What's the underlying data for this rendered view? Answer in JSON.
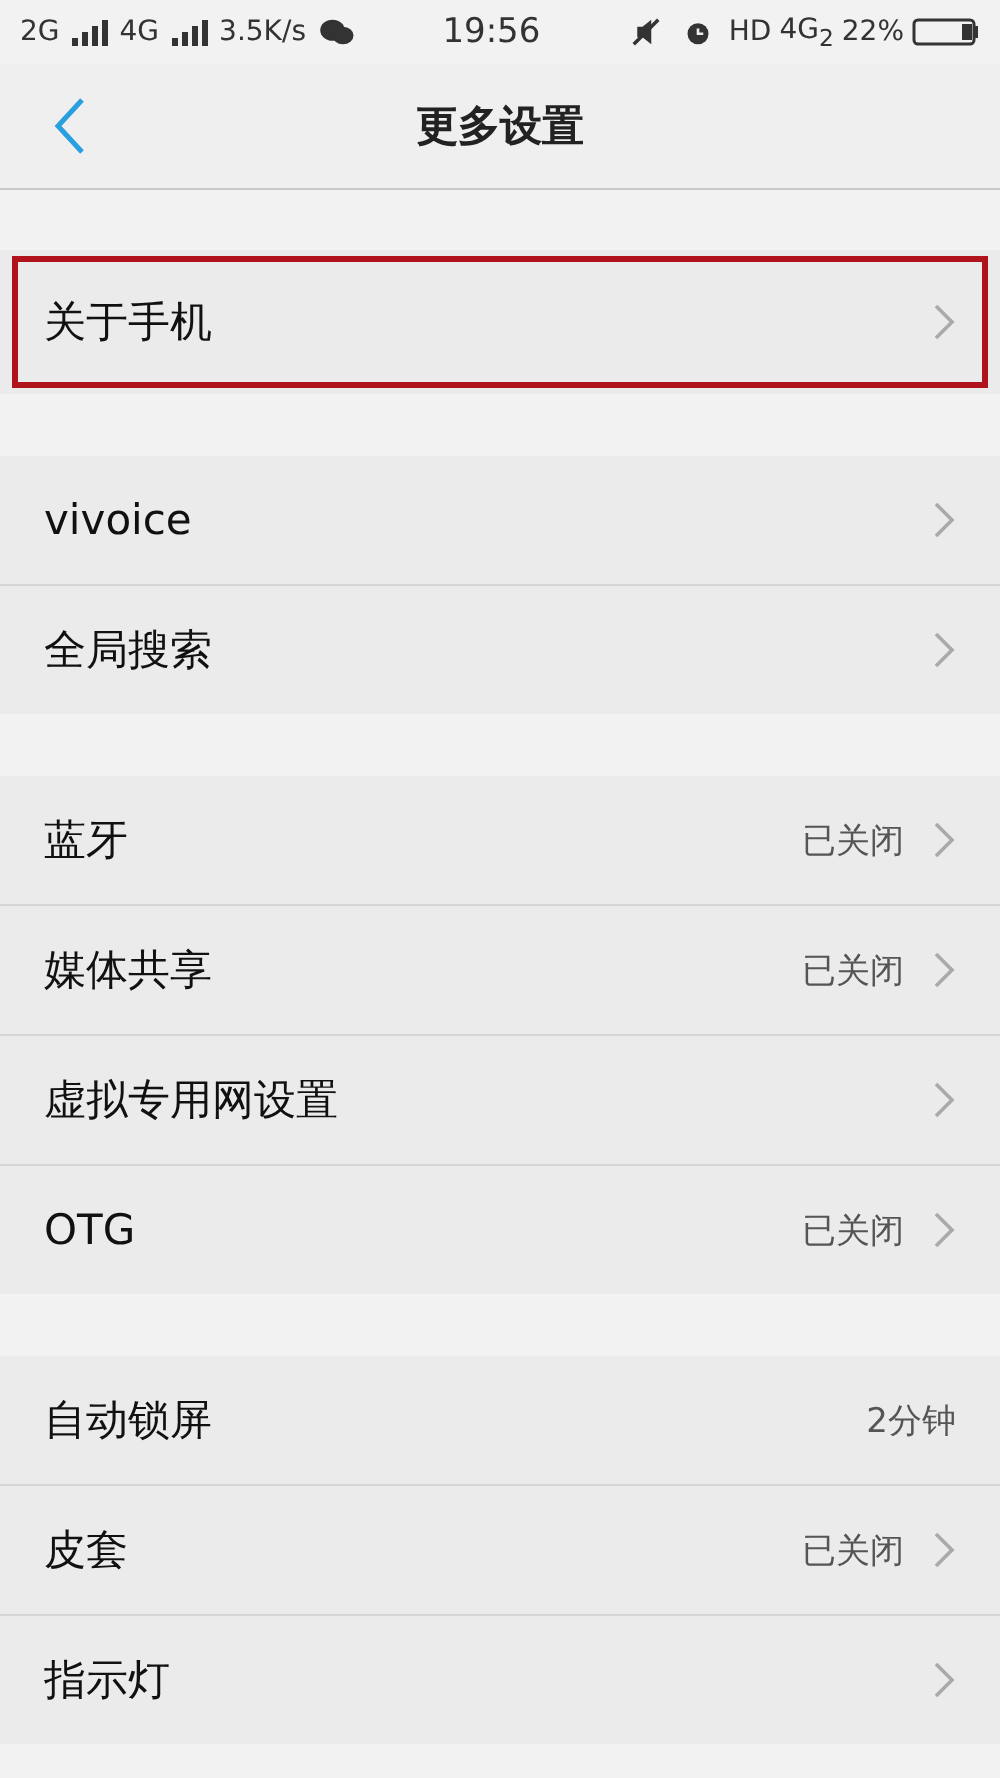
{
  "status_bar": {
    "left": [
      "2G",
      "4G",
      "3.5K/s"
    ],
    "time": "19:56",
    "hd": "HD",
    "network": "4G$_{2}$",
    "battery": "22%"
  },
  "header": {
    "title": "更多设置"
  },
  "groups": [
    {
      "rows": [
        {
          "label": "关于手机",
          "chevron": true,
          "highlighted": true
        }
      ]
    },
    {
      "rows": [
        {
          "label": "vivoice",
          "chevron": true,
          "highlighted": false
        },
        {
          "label": "全局搜索",
          "chevron": true,
          "highlighted": false
        }
      ]
    },
    {
      "rows": [
        {
          "label": "蓝牙",
          "value": "已关闭",
          "chevron": true,
          "highlighted": false
        },
        {
          "label": "媒体共享",
          "value": "已关闭",
          "chevron": true,
          "highlighted": false
        },
        {
          "label": "虚拟专用网设置",
          "chevron": true,
          "highlighted": false
        },
        {
          "label": "OTG",
          "value": "已关闭",
          "chevron": true,
          "highlighted": false
        }
      ]
    },
    {
      "rows": [
        {
          "label": "自动锁屏",
          "value": "2分钟",
          "chevron": false,
          "highlighted": false
        },
        {
          "label": "皮套",
          "value": "已关闭",
          "chevron": true,
          "highlighted": false
        },
        {
          "label": "指示灯",
          "chevron": true,
          "highlighted": false
        }
      ]
    }
  ]
}
